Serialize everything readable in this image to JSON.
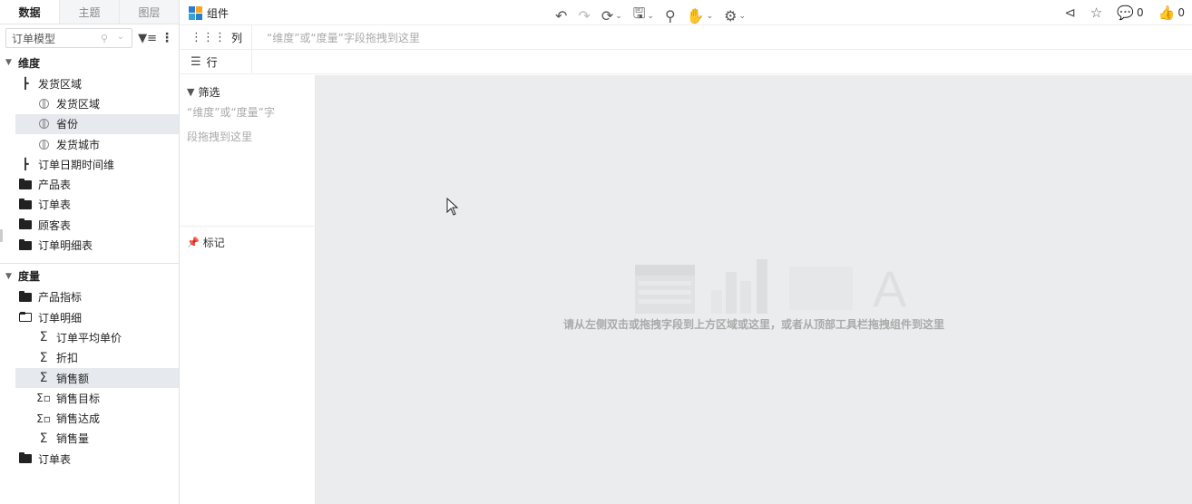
{
  "left_tabs": [
    "数据",
    "主题",
    "图层"
  ],
  "model_select": {
    "value": "订单模型"
  },
  "dimensions": {
    "title": "维度",
    "items": [
      {
        "label": "发货区域",
        "icon": "hierarchy-icon",
        "level": 1
      },
      {
        "label": "发货区域",
        "icon": "globe-icon",
        "level": 2
      },
      {
        "label": "省份",
        "icon": "globe-icon",
        "level": 2,
        "selected": true
      },
      {
        "label": "发货城市",
        "icon": "globe-icon",
        "level": 2
      },
      {
        "label": "订单日期时间维",
        "icon": "hierarchy-icon",
        "level": 1
      },
      {
        "label": "产品表",
        "icon": "folder-icon",
        "level": 1
      },
      {
        "label": "订单表",
        "icon": "folder-icon",
        "level": 1
      },
      {
        "label": "顾客表",
        "icon": "folder-icon",
        "level": 1
      },
      {
        "label": "订单明细表",
        "icon": "folder-icon",
        "level": 1
      }
    ]
  },
  "measures": {
    "title": "度量",
    "items": [
      {
        "label": "产品指标",
        "icon": "folder-icon",
        "level": 1
      },
      {
        "label": "订单明细",
        "icon": "folder-open-icon",
        "level": 1
      },
      {
        "label": "订单平均单价",
        "icon": "sigma-icon",
        "level": 2
      },
      {
        "label": "折扣",
        "icon": "sigma-icon",
        "level": 2
      },
      {
        "label": "销售额",
        "icon": "sigma-icon",
        "level": 2,
        "selected": true
      },
      {
        "label": "销售目标",
        "icon": "calculated-measure-icon",
        "level": 2
      },
      {
        "label": "销售达成",
        "icon": "calculated-measure-icon",
        "level": 2
      },
      {
        "label": "销售量",
        "icon": "sigma-icon",
        "level": 2
      },
      {
        "label": "订单表",
        "icon": "folder-icon",
        "level": 1
      }
    ]
  },
  "toolbar": {
    "component_label": "组件",
    "brand_colors": [
      "#2b7cd3",
      "#f5a623",
      "#34a4d8",
      "#2b7cd3"
    ],
    "comment_count": "0",
    "like_count": "0"
  },
  "shelves": {
    "column_label": "列",
    "row_label": "行",
    "column_placeholder": "“维度”或“度量”字段拖拽到这里"
  },
  "filter": {
    "title": "筛选",
    "hint_line1": "“维度”或“度量”字",
    "hint_line2": "段拖拽到这里"
  },
  "mark": {
    "title": "标记"
  },
  "canvas": {
    "hint": "请从左侧双击或拖拽字段到上方区域或这里，或者从顶部工具栏拖拽组件到这里"
  }
}
